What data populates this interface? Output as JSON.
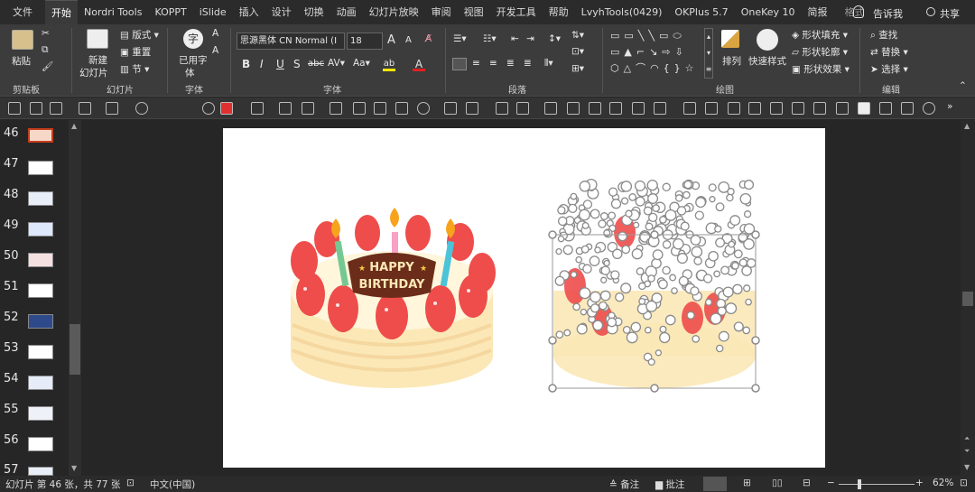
{
  "tabs": [
    {
      "label": "文件"
    },
    {
      "label": "开始",
      "active": true
    },
    {
      "label": "Nordri Tools"
    },
    {
      "label": "KOPPT"
    },
    {
      "label": "iSlide"
    },
    {
      "label": "插入"
    },
    {
      "label": "设计"
    },
    {
      "label": "切换"
    },
    {
      "label": "动画"
    },
    {
      "label": "幻灯片放映"
    },
    {
      "label": "审阅"
    },
    {
      "label": "视图"
    },
    {
      "label": "开发工具"
    },
    {
      "label": "帮助"
    },
    {
      "label": "LvyhTools(0429)"
    },
    {
      "label": "OKPlus 5.7"
    },
    {
      "label": "OneKey 10"
    },
    {
      "label": "简报"
    },
    {
      "label": "格式"
    }
  ],
  "tellme": "告诉我",
  "share": "共享",
  "ribbon": {
    "clipboard": {
      "paste": "粘贴",
      "group": "剪贴板"
    },
    "slides": {
      "new_slide_1": "新建",
      "new_slide_2": "幻灯片",
      "layout": "版式",
      "reset": "重置",
      "section": "节",
      "group": "幻灯片"
    },
    "font_tools": {
      "used_font_1": "已用字",
      "used_font_2": "体",
      "group": "字体"
    },
    "font": {
      "name": "思源黑体 CN Normal (I",
      "size": "18",
      "group": "字体",
      "bold": "B",
      "italic": "I",
      "underline": "U",
      "shadow": "S",
      "strike": "abc",
      "spacing": "AV",
      "case": "Aa",
      "grow": "A",
      "shrink": "A"
    },
    "paragraph": {
      "group": "段落"
    },
    "drawing": {
      "arrange": "排列",
      "quick_styles": "快速样式",
      "fill": "形状填充",
      "outline": "形状轮廓",
      "effects": "形状效果",
      "group": "绘图"
    },
    "editing": {
      "find": "查找",
      "replace": "替换",
      "select": "选择",
      "group": "编辑"
    }
  },
  "thumbnails": [
    {
      "num": "46"
    },
    {
      "num": "47"
    },
    {
      "num": "48"
    },
    {
      "num": "49"
    },
    {
      "num": "50"
    },
    {
      "num": "51"
    },
    {
      "num": "52"
    },
    {
      "num": "53"
    },
    {
      "num": "54"
    },
    {
      "num": "55"
    },
    {
      "num": "56"
    },
    {
      "num": "57"
    }
  ],
  "slide": {
    "cake_text_1": "HAPPY",
    "cake_text_2": "BIRTHDAY"
  },
  "status": {
    "slide_info": "幻灯片 第 46 张，共 77 张",
    "language": "中文(中国)",
    "notes": "备注",
    "comments": "批注",
    "zoom": "62%"
  },
  "colors": {
    "accent": "#c43e1c",
    "strawberry": "#ee4d4b",
    "cream": "#fbe8b6",
    "plaque": "#6b2d1a"
  }
}
